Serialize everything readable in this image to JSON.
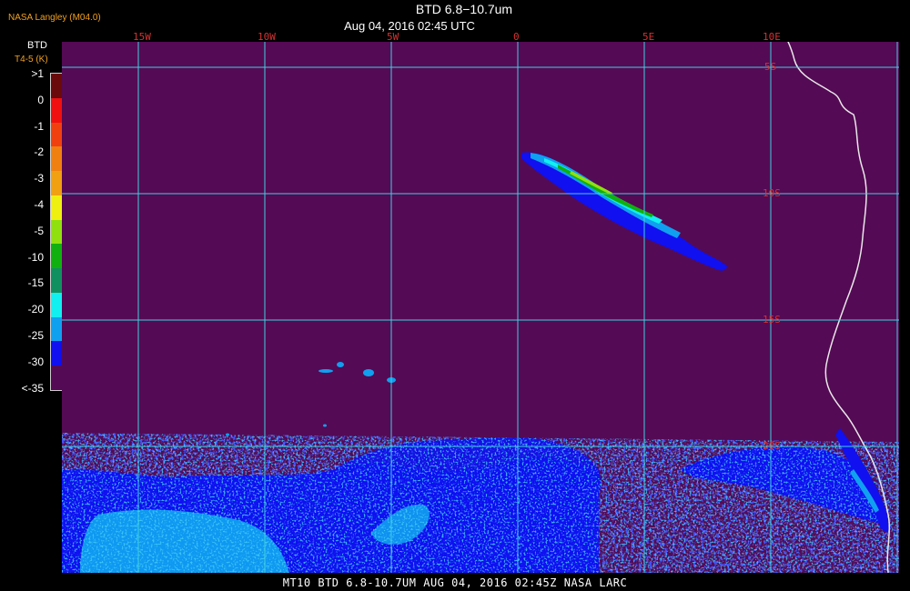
{
  "header": {
    "credit": "NASA Langley (M04.0)",
    "title": "BTD 6.8−10.7um",
    "subtitle": "Aug 04, 2016 02:45 UTC"
  },
  "legend": {
    "title": "BTD",
    "subtitle": "T4-5 (K)",
    "items": [
      {
        "label": ">1",
        "color": "#6a0a0a"
      },
      {
        "label": "0",
        "color": "#f01010"
      },
      {
        "label": "-1",
        "color": "#f04010"
      },
      {
        "label": "-2",
        "color": "#f08010"
      },
      {
        "label": "-3",
        "color": "#f0a010"
      },
      {
        "label": "-4",
        "color": "#f0f010"
      },
      {
        "label": "-5",
        "color": "#90e010"
      },
      {
        "label": "-10",
        "color": "#10b010"
      },
      {
        "label": "-15",
        "color": "#109060"
      },
      {
        "label": "-20",
        "color": "#10f0f0"
      },
      {
        "label": "-25",
        "color": "#10a0f0"
      },
      {
        "label": "-30",
        "color": "#1010f0"
      },
      {
        "label": "<-35",
        "color": "#540a54"
      }
    ]
  },
  "map": {
    "background_color": "#540a54",
    "grid_color": "#40d0e0",
    "longitude_labels": [
      "15W",
      "10W",
      "5W",
      "0",
      "5E",
      "10E"
    ],
    "latitude_labels": [
      "5S",
      "10S",
      "15S",
      "20S"
    ]
  },
  "footer": {
    "text": "MT10  BTD 6.8-10.7UM   AUG 04, 2016 02:45Z   NASA LARC"
  }
}
